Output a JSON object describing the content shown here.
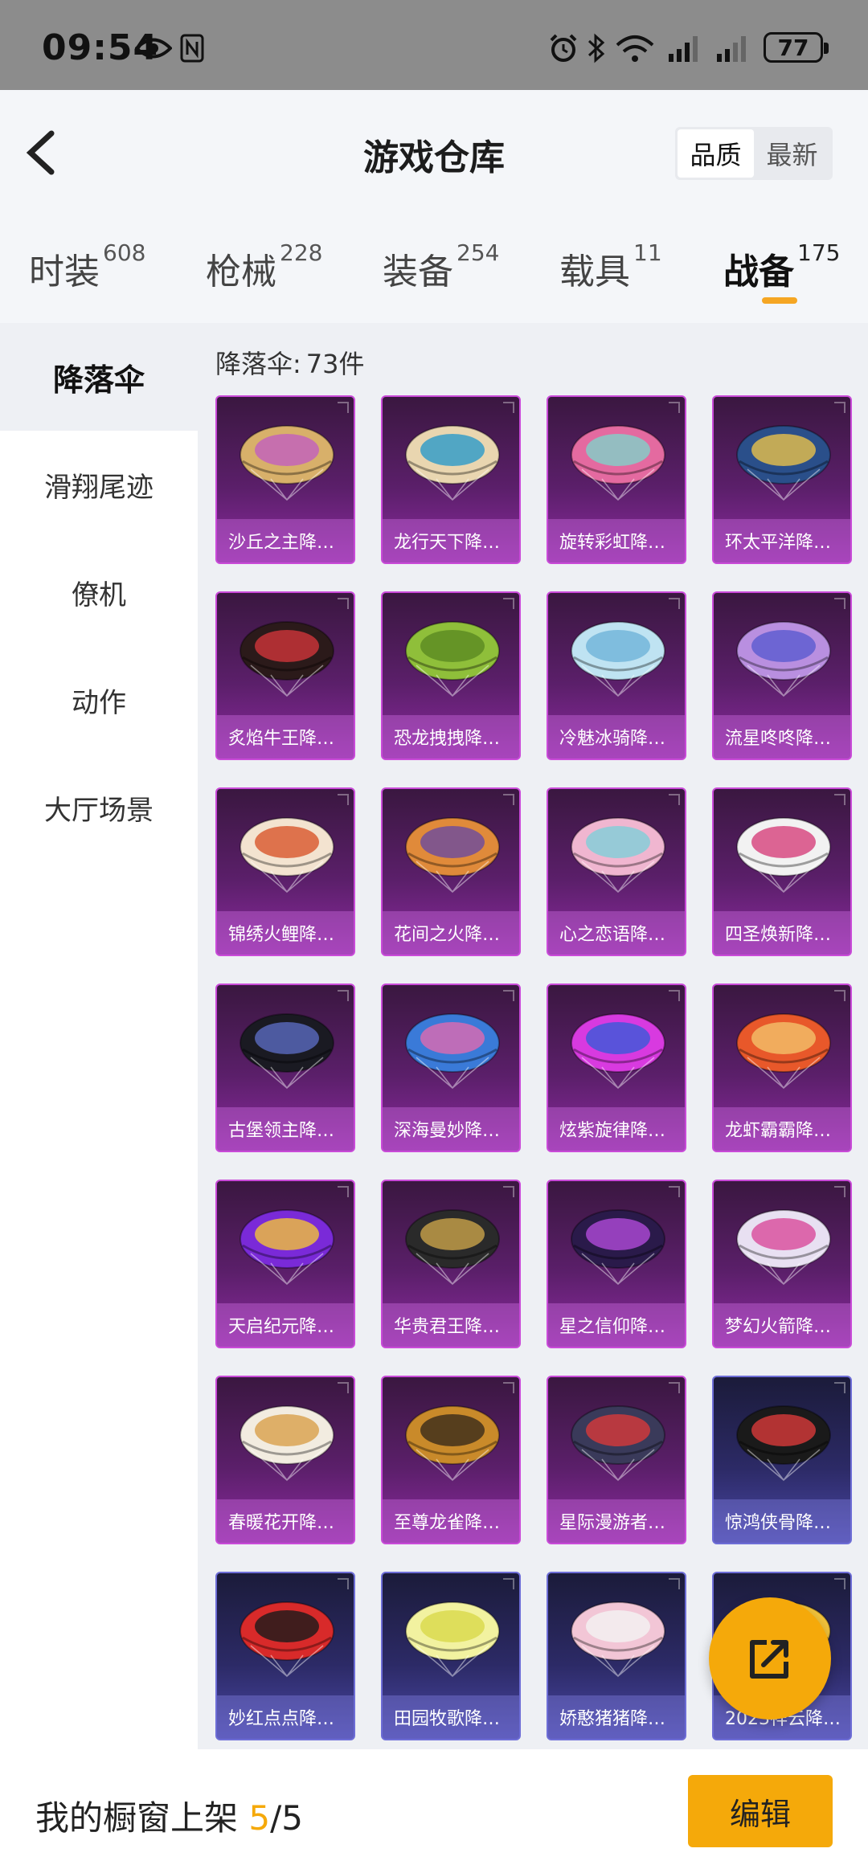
{
  "status_bar": {
    "time": "09:54",
    "battery": "77"
  },
  "header": {
    "title": "游戏仓库",
    "sort_options": [
      "品质",
      "最新"
    ],
    "sort_active": "品质"
  },
  "tabs": [
    {
      "label": "时装",
      "count": "608"
    },
    {
      "label": "枪械",
      "count": "228"
    },
    {
      "label": "装备",
      "count": "254"
    },
    {
      "label": "载具",
      "count": "11"
    },
    {
      "label": "战备",
      "count": "175"
    }
  ],
  "active_tab": "战备",
  "sidebar": {
    "items": [
      {
        "label": "降落伞"
      },
      {
        "label": "滑翔尾迹"
      },
      {
        "label": "僚机"
      },
      {
        "label": "动作"
      },
      {
        "label": "大厅场景"
      }
    ],
    "active": "降落伞"
  },
  "content": {
    "count_prefix": "降落伞:",
    "count_value": "73件",
    "items": [
      {
        "name": "沙丘之主降…",
        "style": "purple",
        "colors": [
          "#d8b06a",
          "#c25fbf"
        ]
      },
      {
        "name": "龙行天下降…",
        "style": "purple",
        "colors": [
          "#e9d6b0",
          "#2a9ac9"
        ]
      },
      {
        "name": "旋转彩虹降…",
        "style": "purple",
        "colors": [
          "#e46aa0",
          "#7fd2c9"
        ]
      },
      {
        "name": "环太平洋降…",
        "style": "purple",
        "colors": [
          "#2a4f8a",
          "#e8c14a"
        ]
      },
      {
        "name": "炙焰牛王降…",
        "style": "purple",
        "colors": [
          "#2b1a1a",
          "#d0343a"
        ]
      },
      {
        "name": "恐龙拽拽降…",
        "style": "purple",
        "colors": [
          "#8fbf3a",
          "#5a8a22"
        ]
      },
      {
        "name": "冷魅冰骑降…",
        "style": "purple",
        "colors": [
          "#bfe3f2",
          "#6fb3d8"
        ]
      },
      {
        "name": "流星咚咚降…",
        "style": "purple",
        "colors": [
          "#b98fe0",
          "#5a5ad0"
        ]
      },
      {
        "name": "锦绣火鲤降…",
        "style": "purple",
        "colors": [
          "#f3e3d0",
          "#d8552a"
        ]
      },
      {
        "name": "花间之火降…",
        "style": "purple",
        "colors": [
          "#e08a3a",
          "#6a4aa0"
        ]
      },
      {
        "name": "心之恋语降…",
        "style": "purple",
        "colors": [
          "#f0b6d0",
          "#7fd0d8"
        ]
      },
      {
        "name": "四圣焕新降…",
        "style": "purple",
        "colors": [
          "#f2f2f2",
          "#d6407a"
        ]
      },
      {
        "name": "古堡领主降…",
        "style": "purple",
        "colors": [
          "#1a1a22",
          "#5a6ac0"
        ]
      },
      {
        "name": "深海曼妙降…",
        "style": "purple",
        "colors": [
          "#3a7ad8",
          "#e06ab0"
        ]
      },
      {
        "name": "炫紫旋律降…",
        "style": "purple",
        "colors": [
          "#d83ae0",
          "#3a5ad8"
        ]
      },
      {
        "name": "龙虾霸霸降…",
        "style": "purple",
        "colors": [
          "#e8582a",
          "#f2c26a"
        ]
      },
      {
        "name": "天启纪元降…",
        "style": "purple",
        "colors": [
          "#7a2ad8",
          "#f2c23a"
        ]
      },
      {
        "name": "华贵君王降…",
        "style": "purple",
        "colors": [
          "#2a2a2a",
          "#c9a34a"
        ]
      },
      {
        "name": "星之信仰降…",
        "style": "purple",
        "colors": [
          "#2a1a4a",
          "#b04ad8"
        ]
      },
      {
        "name": "梦幻火箭降…",
        "style": "purple",
        "colors": [
          "#e8e0f2",
          "#d84a9a"
        ]
      },
      {
        "name": "春暖花开降…",
        "style": "purple",
        "colors": [
          "#f2ece0",
          "#d8a04a"
        ]
      },
      {
        "name": "至尊龙雀降…",
        "style": "purple",
        "colors": [
          "#c98a2a",
          "#3a2a1a"
        ]
      },
      {
        "name": "星际漫游者…",
        "style": "purple",
        "colors": [
          "#3a3a5a",
          "#d83a3a"
        ]
      },
      {
        "name": "惊鸿侠骨降…",
        "style": "blue",
        "colors": [
          "#1a1a1a",
          "#d83a3a"
        ]
      },
      {
        "name": "妙红点点降…",
        "style": "blue",
        "colors": [
          "#d82a2a",
          "#1a1a1a"
        ]
      },
      {
        "name": "田园牧歌降…",
        "style": "blue",
        "colors": [
          "#f2f2a0",
          "#d8d84a"
        ]
      },
      {
        "name": "娇憨猪猪降…",
        "style": "blue",
        "colors": [
          "#f2c6d6",
          "#f2f2f2"
        ]
      },
      {
        "name": "2023祥云降…",
        "style": "blue",
        "colors": [
          "#f2c23a",
          "#d83a3a"
        ]
      }
    ]
  },
  "bottom_bar": {
    "label_prefix": "我的橱窗上架",
    "shelf_current": "5",
    "shelf_total": "/5",
    "edit_label": "编辑"
  }
}
